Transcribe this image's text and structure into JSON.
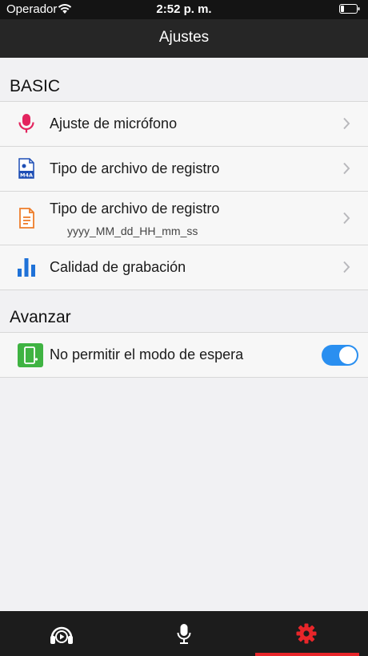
{
  "status_bar": {
    "carrier": "Operador",
    "time": "2:52 p. m."
  },
  "nav": {
    "title": "Ajustes"
  },
  "sections": {
    "basic": {
      "header": "BASIC",
      "rows": [
        {
          "label": "Ajuste de micrófono",
          "icon": "microphone-icon"
        },
        {
          "label": "Tipo de archivo de registro",
          "icon": "m4a-file-icon"
        },
        {
          "label": "Tipo de archivo de registro",
          "sublabel": "yyyy_MM_dd_HH_mm_ss",
          "icon": "document-icon"
        },
        {
          "label": "Calidad de grabación",
          "icon": "bar-chart-icon"
        }
      ]
    },
    "advanced": {
      "header": "Avanzar",
      "rows": [
        {
          "label": "No permitir el modo de espera",
          "icon": "phone-sleep-icon",
          "toggle_on": true
        }
      ]
    }
  },
  "tab_bar": {
    "tabs": [
      {
        "icon": "headphones-play-icon",
        "selected": false
      },
      {
        "icon": "microphone-icon",
        "selected": false
      },
      {
        "icon": "gear-icon",
        "selected": true
      }
    ]
  },
  "colors": {
    "accent_red": "#e8262a",
    "toggle_blue": "#2a8ff0",
    "mic_pink": "#e3245e",
    "chart_blue": "#1f72d8",
    "doc_orange": "#ee7d2a",
    "phone_green": "#3fb342"
  }
}
